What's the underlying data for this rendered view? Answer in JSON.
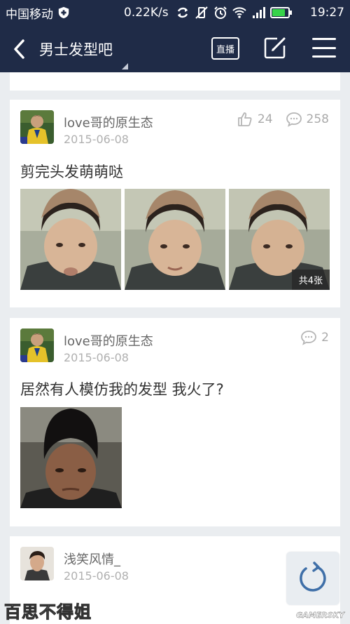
{
  "status_bar": {
    "carrier": "中国移动",
    "speed": "0.22K/s",
    "time": "19:27",
    "battery_level": 0.85,
    "battery_color": "#37d34a"
  },
  "nav": {
    "back_icon": "chevron-left-icon",
    "title": "男士发型吧",
    "live_label": "直播",
    "edit_icon": "edit-icon",
    "menu_icon": "menu-icon",
    "bg_color": "#1f2b47"
  },
  "posts": [
    {
      "username": "love哥的原生态",
      "date": "2015-06-08",
      "likes": "24",
      "comments": "258",
      "text": "剪完头发萌萌哒",
      "photo_count_label": "共4张"
    },
    {
      "username": "love哥的原生态",
      "date": "2015-06-08",
      "comments": "2",
      "text": "居然有人模仿我的发型  我火了?"
    },
    {
      "username": "浅笑风情_",
      "date": "2015-06-08"
    }
  ],
  "fab": {
    "icon": "refresh-icon"
  },
  "watermarks": {
    "left": "百思不得姐",
    "right": "GAMERSKY"
  }
}
